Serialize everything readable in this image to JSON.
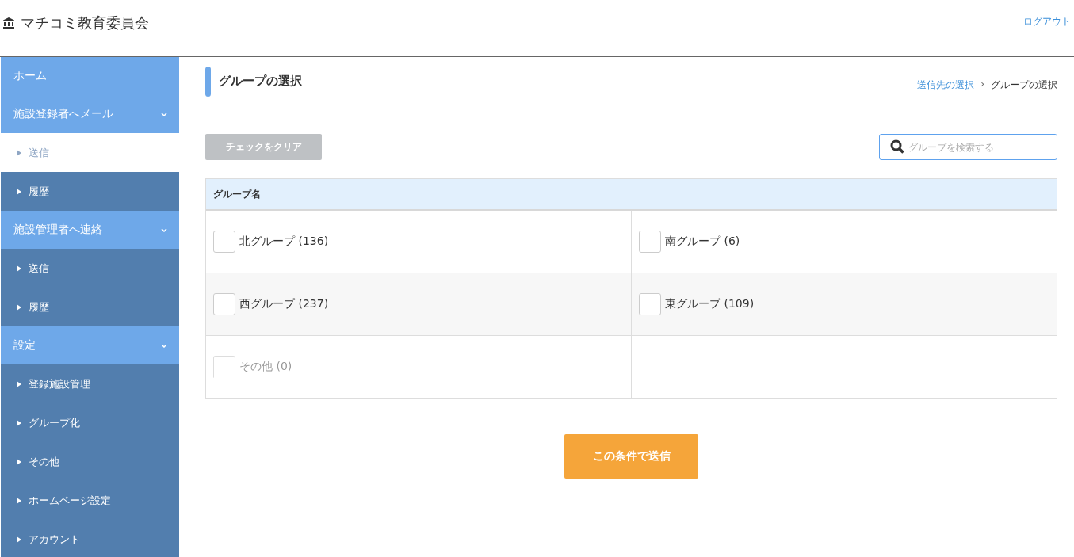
{
  "header": {
    "title": "マチコミ教育委員会",
    "logout": "ログアウト"
  },
  "sidebar": {
    "items": [
      {
        "kind": "section",
        "label": "ホーム",
        "expandable": false,
        "selected": false
      },
      {
        "kind": "section",
        "label": "施設登録者へメール",
        "expandable": true,
        "selected": false
      },
      {
        "kind": "link",
        "label": "送信",
        "selected": true
      },
      {
        "kind": "link",
        "label": "履歴",
        "selected": false
      },
      {
        "kind": "section",
        "label": "施設管理者へ連絡",
        "expandable": true,
        "selected": false
      },
      {
        "kind": "link",
        "label": "送信",
        "selected": false
      },
      {
        "kind": "link",
        "label": "履歴",
        "selected": false
      },
      {
        "kind": "section",
        "label": "設定",
        "expandable": true,
        "selected": false
      },
      {
        "kind": "link",
        "label": "登録施設管理",
        "selected": false
      },
      {
        "kind": "link",
        "label": "グループ化",
        "selected": false
      },
      {
        "kind": "link",
        "label": "その他",
        "selected": false
      },
      {
        "kind": "link",
        "label": "ホームページ設定",
        "selected": false
      },
      {
        "kind": "link",
        "label": "アカウント",
        "selected": false
      }
    ]
  },
  "page": {
    "title": "グループの選択",
    "breadcrumb": [
      {
        "label": "送信先の選択",
        "link": true
      },
      {
        "label": "グループの選択",
        "link": false
      }
    ],
    "separator": "›"
  },
  "toolbar": {
    "clear_button": "チェックをクリア",
    "search": {
      "placeholder": "グループを検索する"
    }
  },
  "table": {
    "column": "グループ名",
    "groups": [
      {
        "label": "北グループ (136)",
        "checked": false,
        "disabled": false
      },
      {
        "label": "南グループ (6)",
        "checked": false,
        "disabled": false
      },
      {
        "label": "西グループ (237)",
        "checked": false,
        "disabled": false
      },
      {
        "label": "東グループ (109)",
        "checked": false,
        "disabled": false
      },
      {
        "label": "その他 (0)",
        "checked": false,
        "disabled": true
      }
    ]
  },
  "submit_button": "この条件で送信"
}
